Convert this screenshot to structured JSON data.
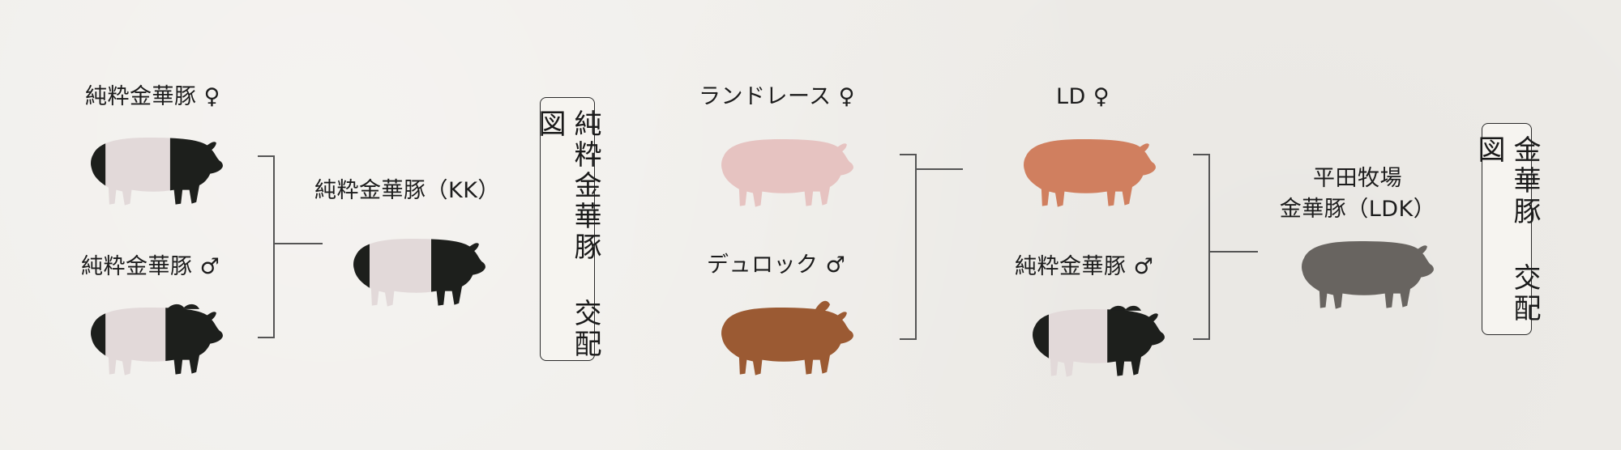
{
  "labels": {
    "pure_female": "純粋金華豚 ♀",
    "pure_male": "純粋金華豚 ♂",
    "pure_kk": "純粋金華豚（KK）",
    "landrace_female": "ランドレース ♀",
    "duroc_male": "デュロック ♂",
    "ld_female": "LD ♀",
    "pure_male_2": "純粋金華豚 ♂",
    "ldk_line1": "平田牧場",
    "ldk_line2": "金華豚（LDK）"
  },
  "boxes": {
    "box1": "純粋金華豚 交配図",
    "box2": "金華豚 交配図"
  },
  "colors": {
    "kinka_black": "#1d1f1c",
    "kinka_pink": "#e2d9d9",
    "landrace": "#e6c3c1",
    "duroc": "#9b5a33",
    "ld": "#d07f5f",
    "ldk": "#686460",
    "line": "#555555"
  }
}
